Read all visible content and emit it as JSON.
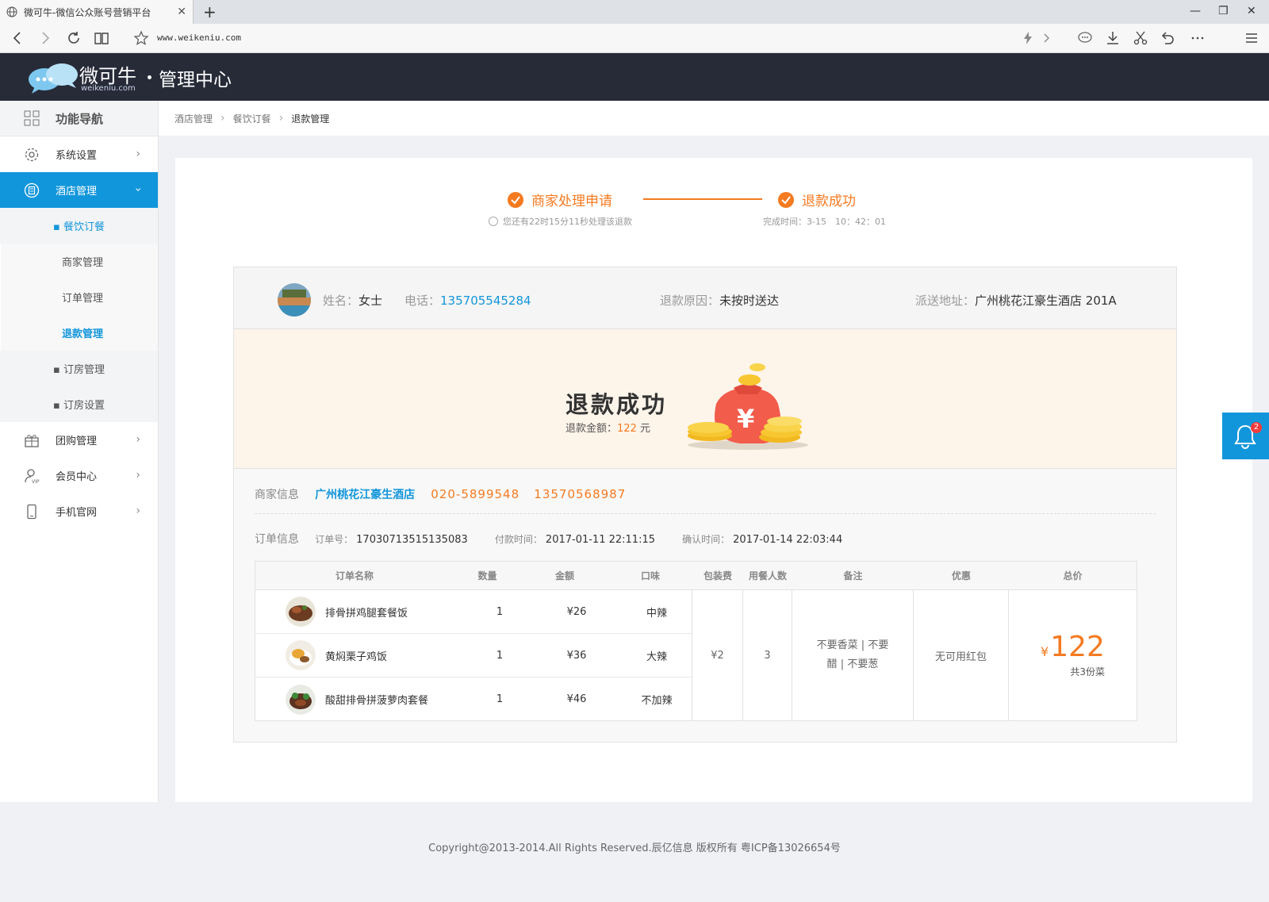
{
  "browser": {
    "tab_title": "微可牛-微信公众账号营销平台",
    "url": "www.weikeniu.com"
  },
  "header": {
    "logo_text": "微可牛",
    "logo_sub": "weikeniu.com",
    "title": "管理中心"
  },
  "sidebar": {
    "nav_head": "功能导航",
    "items": [
      {
        "label": "系统设置",
        "icon": "gear-icon"
      },
      {
        "label": "酒店管理",
        "icon": "hotel-icon"
      },
      {
        "label": "团购管理",
        "icon": "gift-icon"
      },
      {
        "label": "会员中心",
        "icon": "vip-user-icon"
      },
      {
        "label": "手机官网",
        "icon": "phone-icon"
      }
    ],
    "hotel_sub": {
      "current": "▪ 餐饮订餐",
      "children": [
        "商家管理",
        "订单管理",
        "退款管理"
      ],
      "others": [
        "▪ 订房管理",
        "▪ 订房设置"
      ]
    }
  },
  "breadcrumb": {
    "items": [
      "酒店管理",
      "餐饮订餐",
      "退款管理"
    ]
  },
  "steps": {
    "step1": "商家处理申请",
    "step1_sub": "您还有22时15分11秒处理该退款",
    "step2": "退款成功",
    "step2_sub": "完成时间：3-15　10：42：01"
  },
  "customer": {
    "name_label": "姓名：",
    "name": "女士",
    "phone_label": "电话：",
    "phone": "135705545284",
    "reason_label": "退款原因：",
    "reason": "未按时送达",
    "address_label": "派送地址：",
    "address": "广州桃花江豪生酒店 201A"
  },
  "refund": {
    "title": "退款成功",
    "amount_label": "退款金额：",
    "amount": "122",
    "unit": "元"
  },
  "merchant": {
    "label": "商家信息",
    "name": "广州桃花江豪生酒店",
    "tel1": "020-5899548",
    "tel2": "13570568987"
  },
  "order": {
    "label": "订单信息",
    "no_label": "订单号：",
    "no": "17030713515135083",
    "pay_label": "付款时间：",
    "pay_time": "2017-01-11 22:11:15",
    "confirm_label": "确认时间：",
    "confirm_time": "2017-01-14 22:03:44"
  },
  "table": {
    "headers": [
      "订单名称",
      "数量",
      "金额",
      "口味",
      "包装费",
      "用餐人数",
      "备注",
      "优惠",
      "总价"
    ],
    "items": [
      {
        "name": "排骨拼鸡腿套餐饭",
        "qty": "1",
        "price": "¥26",
        "taste": "中辣"
      },
      {
        "name": "黄焖栗子鸡饭",
        "qty": "1",
        "price": "¥36",
        "taste": "大辣"
      },
      {
        "name": "酸甜排骨拼菠萝肉套餐",
        "qty": "1",
        "price": "¥46",
        "taste": "不加辣"
      }
    ],
    "package_fee": "¥2",
    "diners": "3",
    "remark": "不要香菜 | 不要醋 | 不要葱",
    "discount": "无可用红包",
    "total_symbol": "¥",
    "total": "122",
    "total_sub": "共3份菜"
  },
  "notification": {
    "badge": "2"
  },
  "footer": {
    "text": "Copyright@2013-2014.All Rights Reserved.辰亿信息 版权所有 粤ICP备13026654号"
  },
  "colors": {
    "accent": "#1296db",
    "orange": "#f57a20",
    "header_bg": "#272b38"
  }
}
